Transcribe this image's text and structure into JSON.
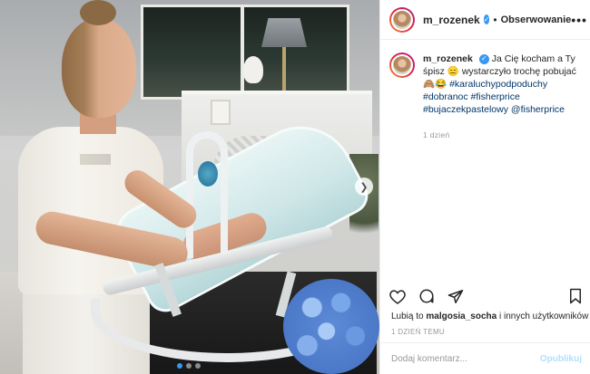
{
  "header": {
    "username": "m_rozenek",
    "separator": "•",
    "follow_label": "Obserwowanie",
    "more_label": "•••"
  },
  "caption": {
    "username": "m_rozenek",
    "text": "Ja Cię kocham a Ty śpisz 😑 wystarczyło trochę pobujać 🙈😂",
    "hashtags": [
      "#karaluchypodpoduchy",
      "#dobranoc",
      "#fisherprice",
      "#bujaczekpastelowy"
    ],
    "mention": "@fisherprice",
    "time": "1 dzień"
  },
  "actions": {
    "like": "heart-icon",
    "comment": "comment-icon",
    "share": "share-icon",
    "save": "bookmark-icon"
  },
  "likes": {
    "prefix": "Lubią to",
    "user": "malgosia_socha",
    "suffix": "i innych użytkowników"
  },
  "date_label": "1 DZIEŃ TEMU",
  "comment": {
    "placeholder": "Dodaj komentarz...",
    "post_label": "Opublikuj"
  },
  "colors": {
    "verified": "#3897f0",
    "link": "#003569",
    "post_disabled": "#b2dffc"
  }
}
